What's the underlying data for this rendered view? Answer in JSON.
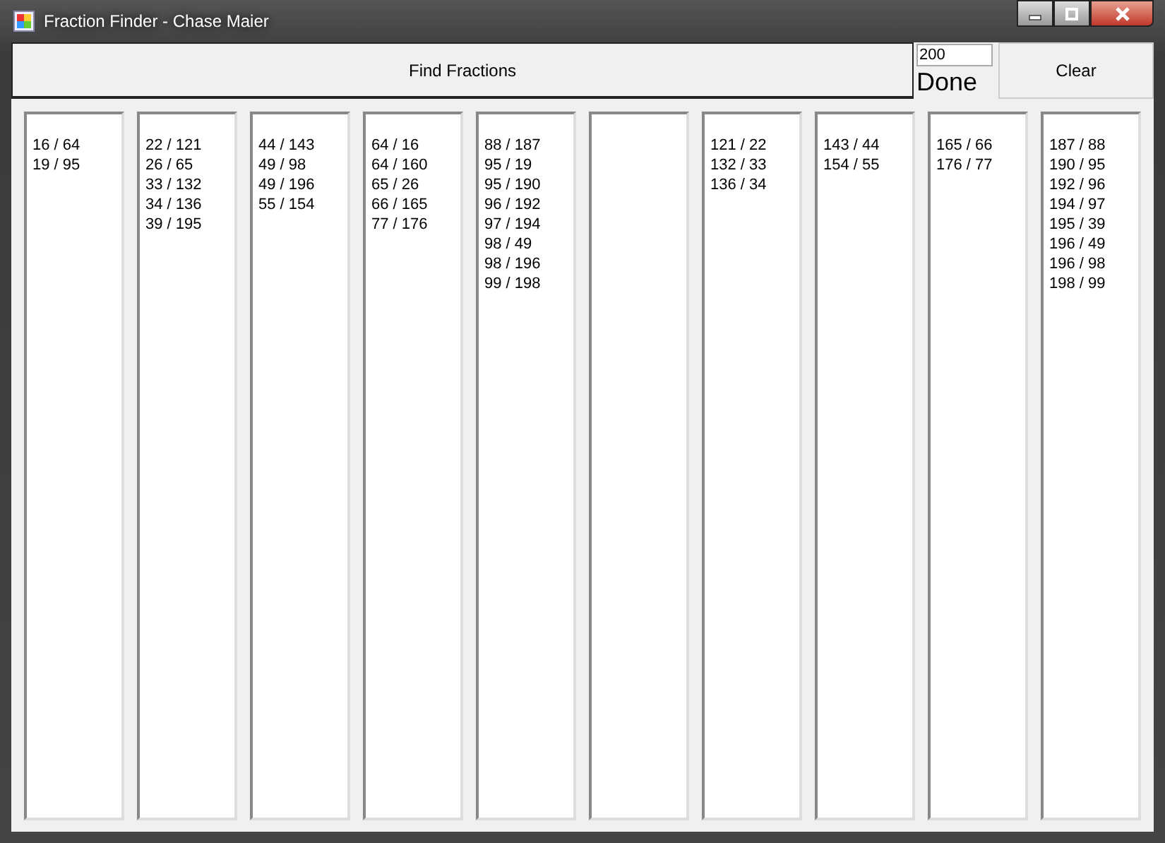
{
  "window": {
    "title": "Fraction Finder - Chase Maier"
  },
  "find_button": "Find Fractions",
  "limit_field": {
    "value": "200"
  },
  "status": "Done",
  "clear_button": "Clear",
  "lists": [
    {
      "kind": "listbox",
      "items": [
        "16 / 64",
        "19 / 95"
      ]
    },
    {
      "kind": "listbox",
      "items": [
        "22 / 121",
        "26 / 65",
        "33 / 132",
        "34 / 136",
        "39 / 195"
      ]
    },
    {
      "kind": "listbox",
      "items": [
        "44 / 143",
        "49 / 98",
        "49 / 196",
        "55 / 154"
      ]
    },
    {
      "kind": "listbox",
      "items": [
        "64 / 16",
        "64 / 160",
        "65 / 26",
        "66 / 165",
        "77 / 176"
      ]
    },
    {
      "kind": "listbox",
      "items": [
        "88 / 187",
        "95 / 19",
        "95 / 190",
        "96 / 192",
        "97 / 194",
        "98 / 49",
        "98 / 196",
        "99 / 198"
      ]
    },
    {
      "kind": "listbox"
    },
    {
      "kind": "listbox",
      "items": [
        "121 / 22",
        "132 / 33",
        "136 / 34"
      ]
    },
    {
      "kind": "listbox",
      "items": [
        "143 / 44",
        "154 / 55"
      ]
    },
    {
      "kind": "listbox",
      "items": [
        "165 / 66",
        "176 / 77"
      ]
    },
    {
      "kind": "listbox",
      "items": [
        "187 / 88",
        "190 / 95",
        "192 / 96",
        "194 / 97",
        "195 / 39",
        "196 / 49",
        "196 / 98",
        "198 / 99"
      ]
    }
  ]
}
